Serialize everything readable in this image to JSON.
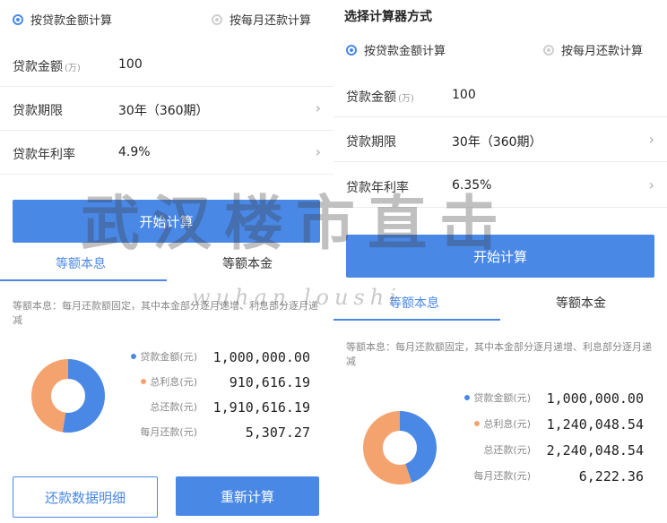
{
  "left": {
    "radio_amount": "按贷款金额计算",
    "radio_monthly": "按每月还款计算",
    "fields": [
      {
        "label": "贷款金额",
        "unit": "(万)",
        "value": "100"
      },
      {
        "label": "贷款期限",
        "unit": "",
        "value": "30年（360期）"
      },
      {
        "label": "贷款年利率",
        "unit": "",
        "value": "4.9%"
      }
    ],
    "calc_button": "开始计算",
    "tab_equal_payment": "等额本息",
    "tab_equal_principal": "等额本金",
    "description": "等额本息：每月还款额固定，其中本金部分逐月递增、利息部分逐月递减",
    "stats": [
      {
        "label": "贷款金额(元)",
        "value": "1,000,000.00"
      },
      {
        "label": "总利息(元)",
        "value": "910,616.19"
      },
      {
        "label": "总还款(元)",
        "value": "1,910,616.19"
      },
      {
        "label": "每月还款(元)",
        "value": "5,307.27"
      }
    ],
    "donut": {
      "principal_fraction": 0.5234,
      "interest_fraction": 0.4766
    },
    "detail_button": "还款数据明细",
    "recalc_button": "重新计算"
  },
  "right": {
    "section_title": "选择计算器方式",
    "radio_amount": "按贷款金额计算",
    "radio_monthly": "按每月还款计算",
    "fields": [
      {
        "label": "贷款金额",
        "unit": "(万)",
        "value": "100"
      },
      {
        "label": "贷款期限",
        "unit": "",
        "value": "30年（360期）"
      },
      {
        "label": "贷款年利率",
        "unit": "",
        "value": "6.35%"
      }
    ],
    "calc_button": "开始计算",
    "tab_equal_payment": "等额本息",
    "tab_equal_principal": "等额本金",
    "description": "等额本息：每月还款额固定，其中本金部分逐月递增、利息部分逐月递减",
    "stats": [
      {
        "label": "贷款金额(元)",
        "value": "1,000,000.00"
      },
      {
        "label": "总利息(元)",
        "value": "1,240,048.54"
      },
      {
        "label": "总还款(元)",
        "value": "2,240,048.54"
      },
      {
        "label": "每月还款(元)",
        "value": "6,222.36"
      }
    ],
    "donut": {
      "principal_fraction": 0.4464,
      "interest_fraction": 0.5536
    }
  },
  "watermark": {
    "main": "武汉楼市直击",
    "sub": "wuhan loushi"
  },
  "colors": {
    "accent": "#4a88e6",
    "interest": "#f5a36e",
    "principal": "#4a88e6"
  }
}
